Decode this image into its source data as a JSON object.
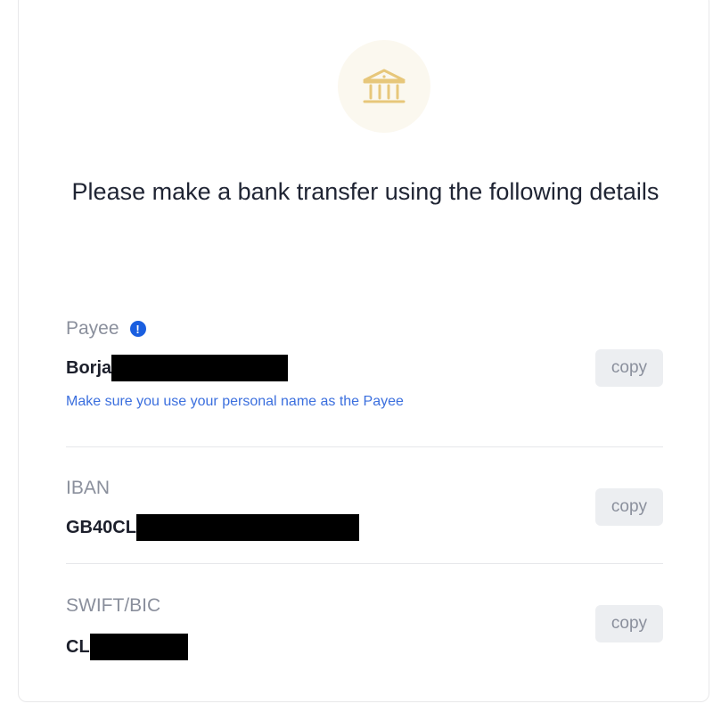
{
  "header": {
    "icon": "bank-icon",
    "title": "Please make a bank transfer using the following details"
  },
  "payee": {
    "label": "Payee",
    "info_icon": "info-icon",
    "info_glyph": "!",
    "value": "Borja",
    "hint": "Make sure you use your personal name as the Payee",
    "copy_label": "copy"
  },
  "iban": {
    "label": "IBAN",
    "value": "GB40CL",
    "copy_label": "copy"
  },
  "swift": {
    "label": "SWIFT/BIC",
    "value": "CL",
    "copy_label": "copy"
  },
  "colors": {
    "accent_blue": "#1a5fe0",
    "hint_blue": "#3b6fde",
    "icon_gold": "#e7c77a",
    "icon_bg": "#fbf8ef",
    "button_bg": "#eceef1",
    "text_dark": "#1c1f2b",
    "text_muted": "#8a8f9c"
  }
}
